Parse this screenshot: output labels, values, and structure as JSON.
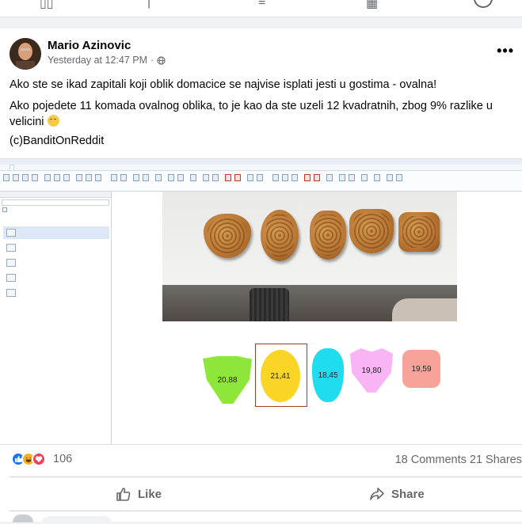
{
  "post": {
    "author": "Mario Azinovic",
    "timestamp": "Yesterday at 12:47 PM",
    "privacy_icon": "globe-icon",
    "line1": "Ako ste se ikad zapitali koji oblik domacice se najvise isplati jesti u gostima - ovalna!",
    "line2": "Ako pojedete 11 komada ovalnog oblika, to je kao da ste uzeli 12 kvadratnih, zbog 9% razlike u velicini",
    "line2_emoji": "smirking-face-emoji",
    "line3": "(c)BanditOnReddit"
  },
  "screenshot": {
    "shapes": [
      {
        "label": "20,88",
        "color": "#8ee63a"
      },
      {
        "label": "21,41",
        "color": "#fbd526"
      },
      {
        "label": "18,45",
        "color": "#1fdcee"
      },
      {
        "label": "19,80",
        "color": "#f8b4f4"
      },
      {
        "label": "19,59",
        "color": "#f7a39a"
      }
    ]
  },
  "footer": {
    "reaction_count": "106",
    "comments": "18 Comments",
    "shares": "21 Shares",
    "like_label": "Like",
    "share_label": "Share",
    "reaction_icons": [
      "like-icon",
      "haha-icon",
      "love-icon"
    ]
  },
  "colors": {
    "facebook_blue": "#1877f2",
    "love_red": "#f33e58",
    "haha_yellow": "#f7b125",
    "secondary_text": "#65676b"
  }
}
